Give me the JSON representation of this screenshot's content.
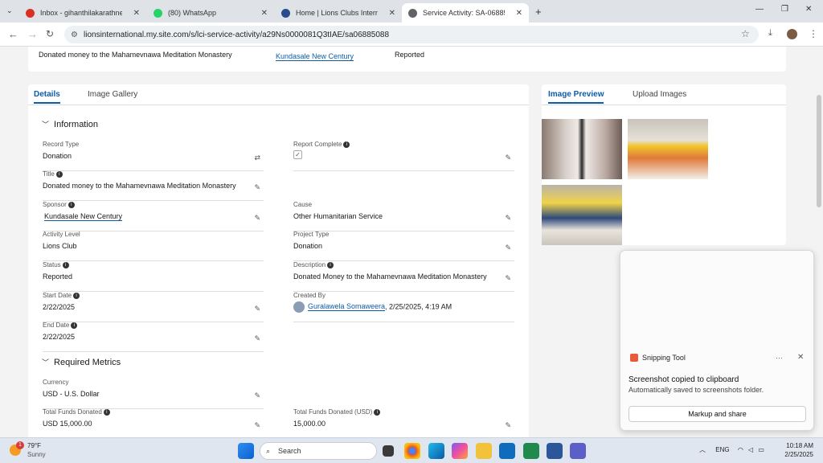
{
  "browser": {
    "tabs": [
      {
        "title": "Inbox - gihanthilakarathne040€",
        "icon_color": "#d93025",
        "icon": "gmail-icon"
      },
      {
        "title": "(80) WhatsApp",
        "icon_color": "#25d366",
        "icon": "whatsapp-icon"
      },
      {
        "title": "Home | Lions Clubs Internationa",
        "icon_color": "#2a4b8d",
        "icon": "lions-icon"
      },
      {
        "title": "Service Activity: SA-06885088",
        "icon_color": "#5f6368",
        "icon": "globe-icon"
      }
    ],
    "url": "lionsinternational.my.site.com/s/lci-service-activity/a29Ns0000081Q3tIAE/sa06885088"
  },
  "topcard": {
    "title": "Donated money to the Mahamevnawa Meditation Monastery",
    "sponsor": "Kundasale New Century",
    "status": "Reported"
  },
  "details": {
    "tabs": [
      "Details",
      "Image Gallery"
    ],
    "section_info": "Information",
    "section_metrics": "Required Metrics",
    "fields": {
      "record_type": {
        "label": "Record Type",
        "value": "Donation"
      },
      "report_complete": {
        "label": "Report Complete",
        "value": "✓"
      },
      "title": {
        "label": "Title",
        "value": "Donated money to the Mahamevnawa Meditation Monastery"
      },
      "sponsor": {
        "label": "Sponsor",
        "value": "Kundasale New Century"
      },
      "cause": {
        "label": "Cause",
        "value": "Other Humanitarian Service"
      },
      "activity_level": {
        "label": "Activity Level",
        "value": "Lions Club"
      },
      "project_type": {
        "label": "Project Type",
        "value": "Donation"
      },
      "status": {
        "label": "Status",
        "value": "Reported"
      },
      "description": {
        "label": "Description",
        "value": "Donated Money to the Mahamevnawa Meditation Monastery"
      },
      "start_date": {
        "label": "Start Date",
        "value": "2/22/2025"
      },
      "created_by": {
        "label": "Created By",
        "user": "Guralawela Somaweera",
        "date": ", 2/25/2025, 4:19 AM"
      },
      "end_date": {
        "label": "End Date",
        "value": "2/22/2025"
      },
      "currency": {
        "label": "Currency",
        "value": "USD - U.S. Dollar"
      },
      "total_funds": {
        "label": "Total Funds Donated",
        "value": "USD 15,000.00"
      },
      "total_funds_usd": {
        "label": "Total Funds Donated (USD)",
        "value": "15,000.00"
      }
    }
  },
  "preview": {
    "tabs": [
      "Image Preview",
      "Upload Images"
    ]
  },
  "toast": {
    "app": "Snipping Tool",
    "title": "Screenshot copied to clipboard",
    "subtitle": "Automatically saved to screenshots folder.",
    "button": "Markup and share"
  },
  "taskbar": {
    "weather_temp": "79°F",
    "weather_desc": "Sunny",
    "weather_badge": "1",
    "search": "Search",
    "lang": "ENG",
    "time": "10:18 AM",
    "date": "2/25/2025"
  }
}
